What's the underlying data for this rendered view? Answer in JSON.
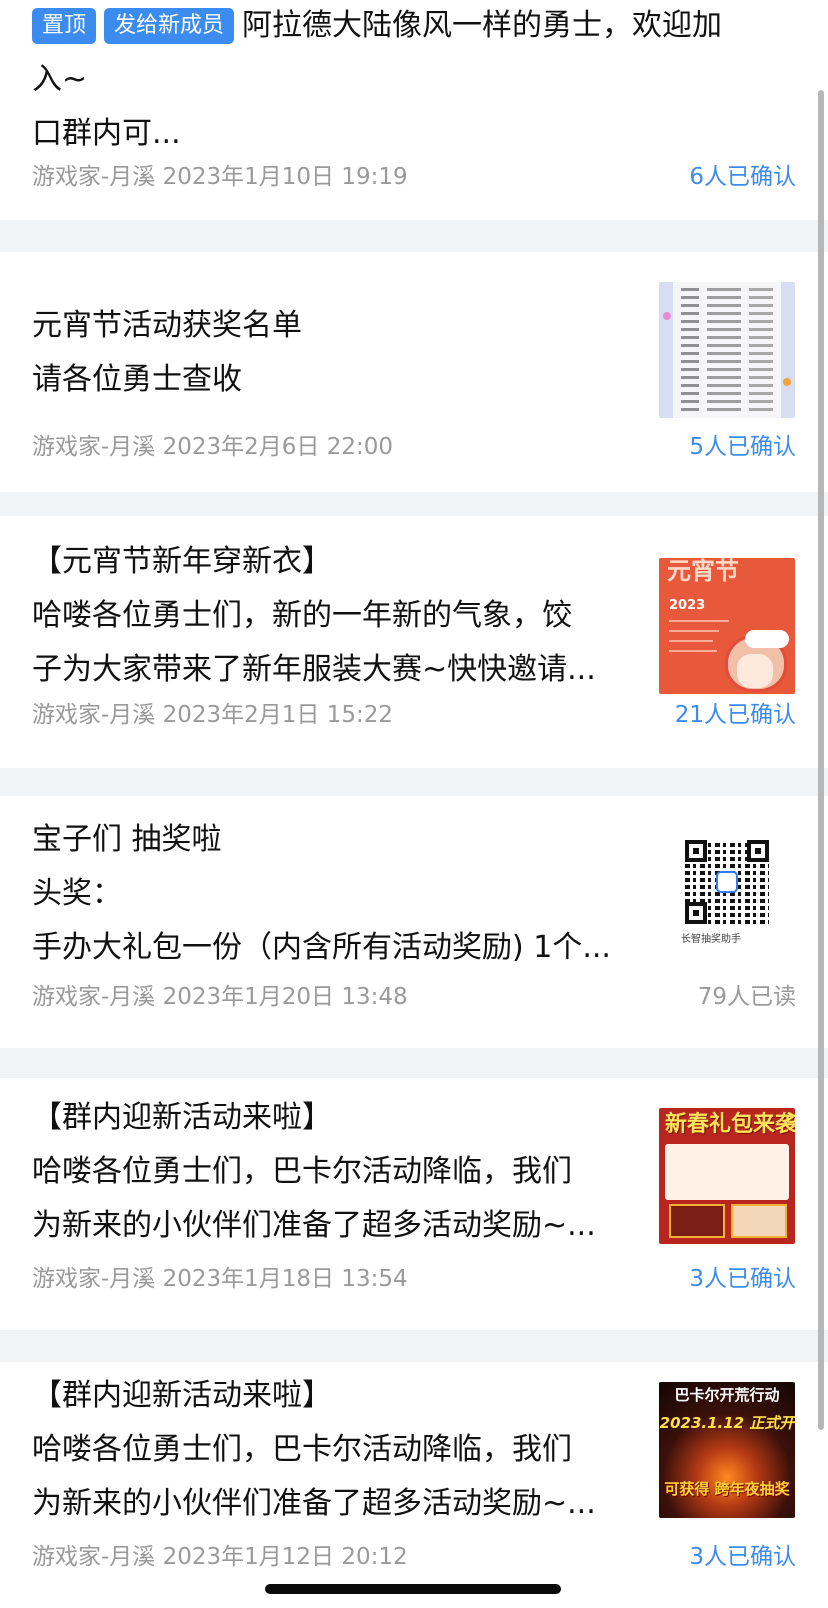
{
  "colors": {
    "page_background": "#f2f3f5",
    "card_background": "#ffffff",
    "tag_blue": "#3c8cf0",
    "confirm_blue": "#3c8cf0",
    "read_gray": "#9a9a9a"
  },
  "posts": [
    {
      "tags": [
        "置顶",
        "发给新成员"
      ],
      "lines": [
        "阿拉德大陆像风一样的勇士，欢迎加",
        "入~",
        "口群内可..."
      ],
      "meta": "游戏家-月溪 2023年1月10日 19:19",
      "status": "6人已确认",
      "status_type": "confirmed"
    },
    {
      "lines": [
        "元宵节活动获奖名单",
        "请各位勇士查收"
      ],
      "meta": "游戏家-月溪 2023年2月6日 22:00",
      "status": "5人已确认",
      "status_type": "confirmed",
      "thumbnail": "winner-list-image"
    },
    {
      "lines": [
        "【元宵节新年穿新衣】",
        "哈喽各位勇士们，新的一年新的气象，饺",
        "子为大家带来了新年服装大赛~快快邀请..."
      ],
      "meta": "游戏家-月溪 2023年2月1日 15:22",
      "status": "21人已确认",
      "status_type": "confirmed",
      "thumbnail": "costume-poster-image",
      "thumbnail_text": {
        "title": "元宵节",
        "year": "2023"
      }
    },
    {
      "lines": [
        "宝子们 抽奖啦",
        "头奖：",
        "手办大礼包一份（内含所有活动奖励) 1个..."
      ],
      "meta": "游戏家-月溪 2023年1月20日 13:48",
      "status": "79人已读",
      "status_type": "read",
      "thumbnail": "qr-code-image",
      "thumbnail_text": {
        "caption": "长智抽奖助手"
      }
    },
    {
      "lines": [
        "【群内迎新活动来啦】",
        "哈喽各位勇士们，巴卡尔活动降临，我们",
        "为新来的小伙伴们准备了超多活动奖励~..."
      ],
      "meta": "游戏家-月溪 2023年1月18日 13:54",
      "status": "3人已确认",
      "status_type": "confirmed",
      "thumbnail": "spring-gift-poster-image",
      "thumbnail_text": {
        "title": "新春礼包来袭"
      }
    },
    {
      "lines": [
        "【群内迎新活动来啦】",
        "哈喽各位勇士们，巴卡尔活动降临，我们",
        "为新来的小伙伴们准备了超多活动奖励~..."
      ],
      "meta": "游戏家-月溪 2023年1月12日 20:12",
      "status": "3人已确认",
      "status_type": "confirmed",
      "thumbnail": "bakal-raid-poster-image",
      "thumbnail_text": {
        "title": "巴卡尔开荒行动",
        "date": "2023.1.12 正式开",
        "footer": "可获得 跨年夜抽奖"
      }
    }
  ]
}
